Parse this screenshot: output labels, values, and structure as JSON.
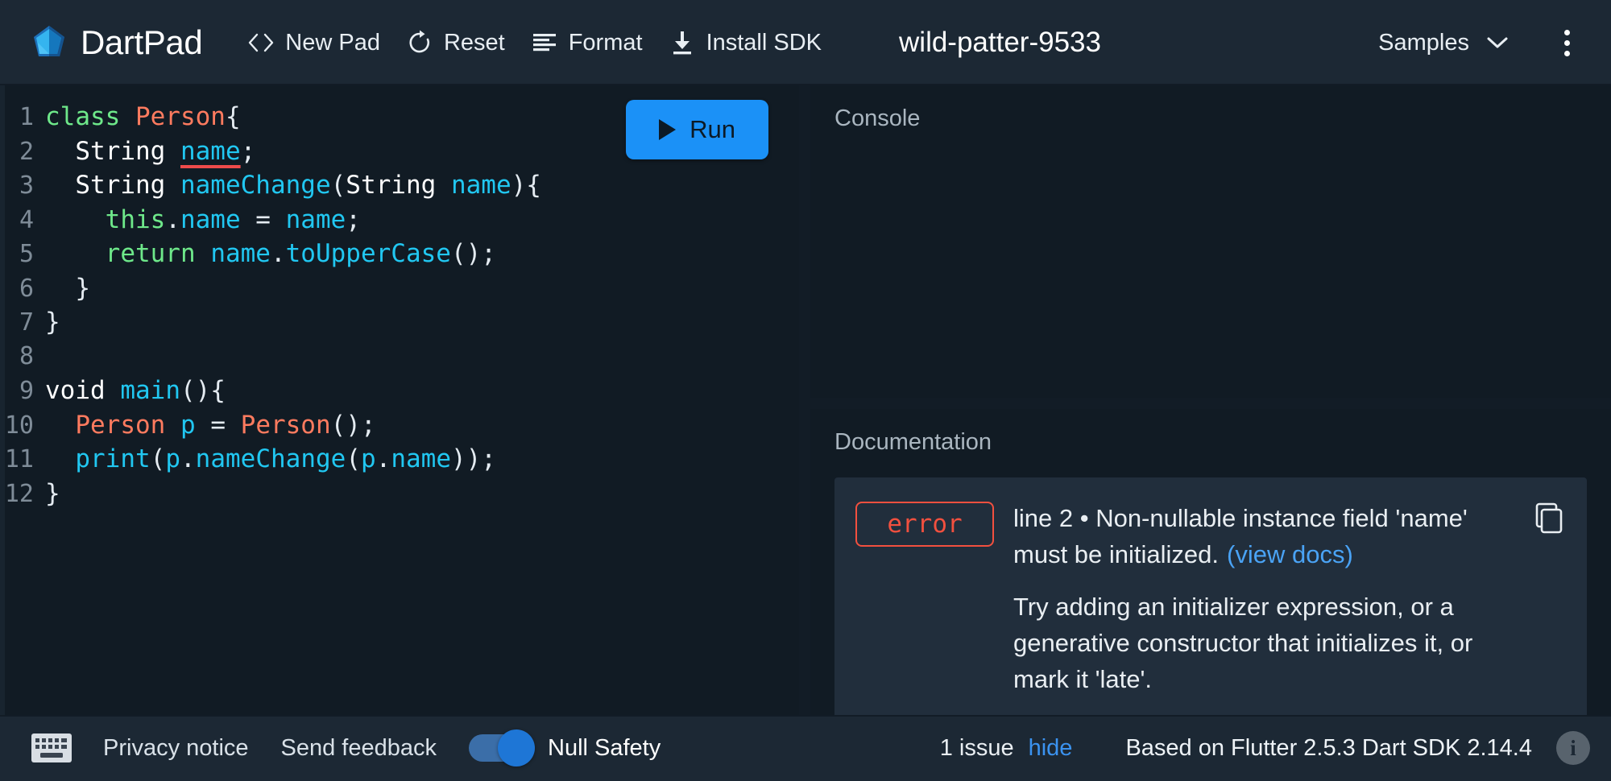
{
  "app": {
    "brand_name": "DartPad",
    "logo_icon": "dart-logo-icon"
  },
  "header": {
    "actions": [
      {
        "label": "New Pad",
        "icon": "code-brackets-icon"
      },
      {
        "label": "Reset",
        "icon": "refresh-icon"
      },
      {
        "label": "Format",
        "icon": "format-align-icon"
      },
      {
        "label": "Install SDK",
        "icon": "download-icon"
      }
    ],
    "pad_title": "wild-patter-9533",
    "samples_label": "Samples",
    "samples_chevron_icon": "chevron-down-icon",
    "overflow_icon": "kebab-menu-icon"
  },
  "editor": {
    "run_label": "Run",
    "run_icon": "play-icon",
    "lines": [
      {
        "num": "1",
        "tokens": [
          {
            "t": "class ",
            "c": "t-kw"
          },
          {
            "t": "Person",
            "c": "t-cls"
          },
          {
            "t": "{",
            "c": "t-pl"
          }
        ]
      },
      {
        "num": "2",
        "tokens": [
          {
            "t": "  ",
            "c": "t-pl"
          },
          {
            "t": "String",
            "c": "t-type"
          },
          {
            "t": " ",
            "c": "t-pl"
          },
          {
            "t": "name",
            "c": "t-id err-underline"
          },
          {
            "t": ";",
            "c": "t-pl"
          }
        ]
      },
      {
        "num": "3",
        "tokens": [
          {
            "t": "  ",
            "c": "t-pl"
          },
          {
            "t": "String",
            "c": "t-type"
          },
          {
            "t": " ",
            "c": "t-pl"
          },
          {
            "t": "nameChange",
            "c": "t-id"
          },
          {
            "t": "(",
            "c": "t-pl"
          },
          {
            "t": "String",
            "c": "t-type"
          },
          {
            "t": " ",
            "c": "t-pl"
          },
          {
            "t": "name",
            "c": "t-id"
          },
          {
            "t": "){",
            "c": "t-pl"
          }
        ]
      },
      {
        "num": "4",
        "tokens": [
          {
            "t": "    ",
            "c": "t-pl"
          },
          {
            "t": "this",
            "c": "t-kw"
          },
          {
            "t": ".",
            "c": "t-pl"
          },
          {
            "t": "name",
            "c": "t-id"
          },
          {
            "t": " = ",
            "c": "t-pl"
          },
          {
            "t": "name",
            "c": "t-id"
          },
          {
            "t": ";",
            "c": "t-pl"
          }
        ]
      },
      {
        "num": "5",
        "tokens": [
          {
            "t": "    ",
            "c": "t-pl"
          },
          {
            "t": "return",
            "c": "t-kw"
          },
          {
            "t": " ",
            "c": "t-pl"
          },
          {
            "t": "name",
            "c": "t-id"
          },
          {
            "t": ".",
            "c": "t-pl"
          },
          {
            "t": "toUpperCase",
            "c": "t-id"
          },
          {
            "t": "();",
            "c": "t-pl"
          }
        ]
      },
      {
        "num": "6",
        "tokens": [
          {
            "t": "  }",
            "c": "t-pl"
          }
        ]
      },
      {
        "num": "7",
        "tokens": [
          {
            "t": "}",
            "c": "t-pl"
          }
        ]
      },
      {
        "num": "8",
        "tokens": [
          {
            "t": "",
            "c": "t-pl"
          }
        ]
      },
      {
        "num": "9",
        "tokens": [
          {
            "t": "void",
            "c": "t-type"
          },
          {
            "t": " ",
            "c": "t-pl"
          },
          {
            "t": "main",
            "c": "t-id"
          },
          {
            "t": "(){",
            "c": "t-pl"
          }
        ]
      },
      {
        "num": "10",
        "tokens": [
          {
            "t": "  ",
            "c": "t-pl"
          },
          {
            "t": "Person",
            "c": "t-cls"
          },
          {
            "t": " ",
            "c": "t-pl"
          },
          {
            "t": "p",
            "c": "t-id"
          },
          {
            "t": " = ",
            "c": "t-pl"
          },
          {
            "t": "Person",
            "c": "t-cls"
          },
          {
            "t": "();",
            "c": "t-pl"
          }
        ]
      },
      {
        "num": "11",
        "tokens": [
          {
            "t": "  ",
            "c": "t-pl"
          },
          {
            "t": "print",
            "c": "t-id"
          },
          {
            "t": "(",
            "c": "t-pl"
          },
          {
            "t": "p",
            "c": "t-id"
          },
          {
            "t": ".",
            "c": "t-pl"
          },
          {
            "t": "nameChange",
            "c": "t-id"
          },
          {
            "t": "(",
            "c": "t-pl"
          },
          {
            "t": "p",
            "c": "t-id"
          },
          {
            "t": ".",
            "c": "t-pl"
          },
          {
            "t": "name",
            "c": "t-id"
          },
          {
            "t": "));",
            "c": "t-pl"
          }
        ]
      },
      {
        "num": "12",
        "tokens": [
          {
            "t": "}",
            "c": "t-pl"
          }
        ]
      }
    ]
  },
  "console": {
    "title": "Console",
    "output": ""
  },
  "documentation": {
    "title": "Documentation",
    "issue": {
      "severity": "error",
      "message": "line 2 • Non-nullable instance field 'name' must be initialized.",
      "view_docs_label": "(view docs)",
      "hint": "Try adding an initializer expression, or a generative constructor that initializes it, or mark it 'late'.",
      "copy_icon": "copy-icon"
    }
  },
  "footer": {
    "keyboard_icon": "keyboard-icon",
    "privacy_label": "Privacy notice",
    "feedback_label": "Send feedback",
    "null_safety_label": "Null Safety",
    "null_safety_on": true,
    "issue_count": "1 issue",
    "hide_label": "hide",
    "sdk_text": "Based on Flutter 2.5.3 Dart SDK 2.14.4",
    "info_icon": "info-icon",
    "info_glyph": "i"
  },
  "colors": {
    "accent_blue": "#1b91f7",
    "link_blue": "#4aa3f5",
    "error_red": "#f2503f",
    "header_bg": "#1c2834",
    "editor_bg": "#111b24",
    "card_bg": "#212e3c"
  }
}
